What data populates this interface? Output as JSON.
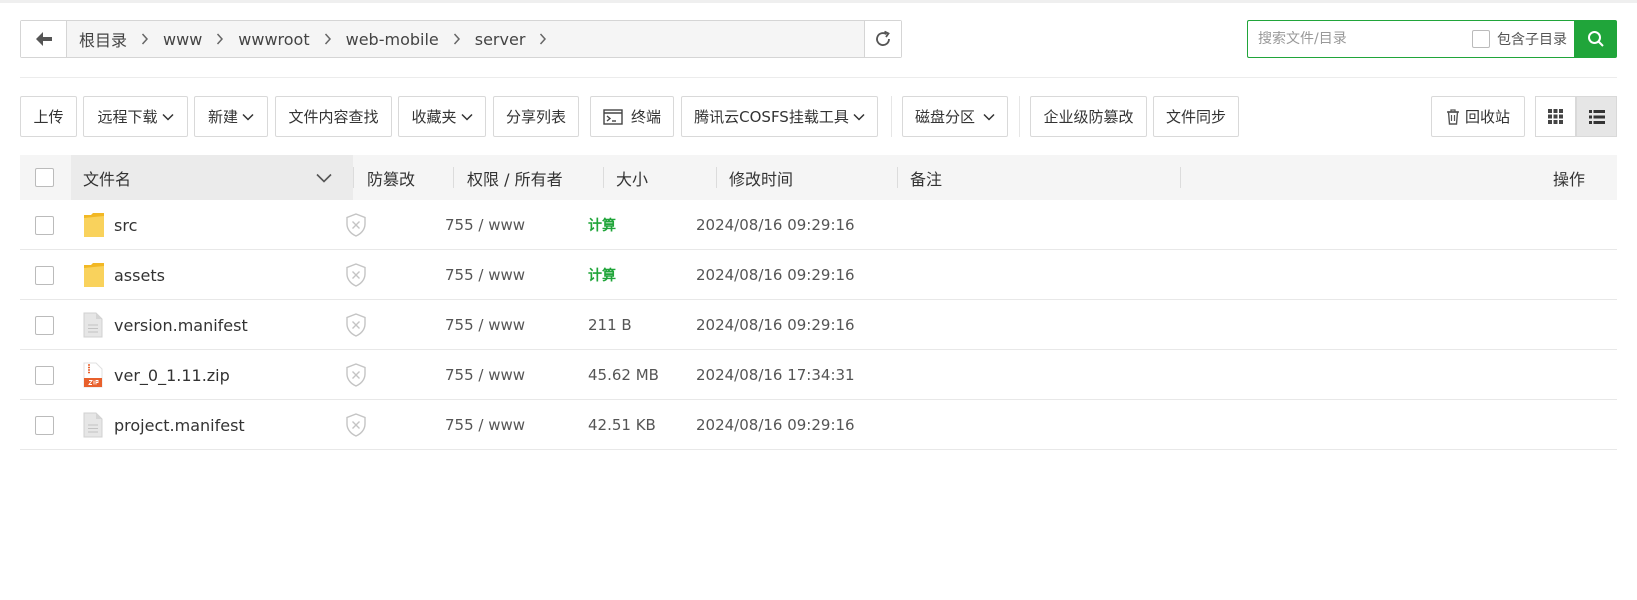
{
  "breadcrumb": {
    "items": [
      "根目录",
      "www",
      "wwwroot",
      "web-mobile",
      "server"
    ]
  },
  "search": {
    "placeholder": "搜索文件/目录",
    "include_subdir_label": "包含子目录"
  },
  "toolbar": {
    "upload": "上传",
    "remote_download": "远程下载",
    "new": "新建",
    "content_search": "文件内容查找",
    "favorites": "收藏夹",
    "share_list": "分享列表",
    "terminal": "终端",
    "cosfs_tool": "腾讯云COSFS挂载工具",
    "disk_partition": "磁盘分区",
    "tamper_proof": "企业级防篡改",
    "file_sync": "文件同步",
    "recycle_bin": "回收站"
  },
  "table": {
    "headers": {
      "name": "文件名",
      "tamper": "防篡改",
      "perm_owner": "权限 / 所有者",
      "size": "大小",
      "modified": "修改时间",
      "remark": "备注",
      "actions": "操作"
    },
    "rows": [
      {
        "name": "src",
        "type": "folder",
        "perm": "755 / www",
        "size": "计算",
        "modified": "2024/08/16 09:29:16"
      },
      {
        "name": "assets",
        "type": "folder",
        "perm": "755 / www",
        "size": "计算",
        "modified": "2024/08/16 09:29:16"
      },
      {
        "name": "version.manifest",
        "type": "file",
        "perm": "755 / www",
        "size": "211 B",
        "modified": "2024/08/16 09:29:16"
      },
      {
        "name": "ver_0_1.11.zip",
        "type": "zip",
        "perm": "755 / www",
        "size": "45.62 MB",
        "modified": "2024/08/16 17:34:31"
      },
      {
        "name": "project.manifest",
        "type": "file",
        "perm": "755 / www",
        "size": "42.51 KB",
        "modified": "2024/08/16 09:29:16"
      }
    ]
  },
  "colors": {
    "accent": "#20a53a",
    "folder": "#f7c948"
  }
}
